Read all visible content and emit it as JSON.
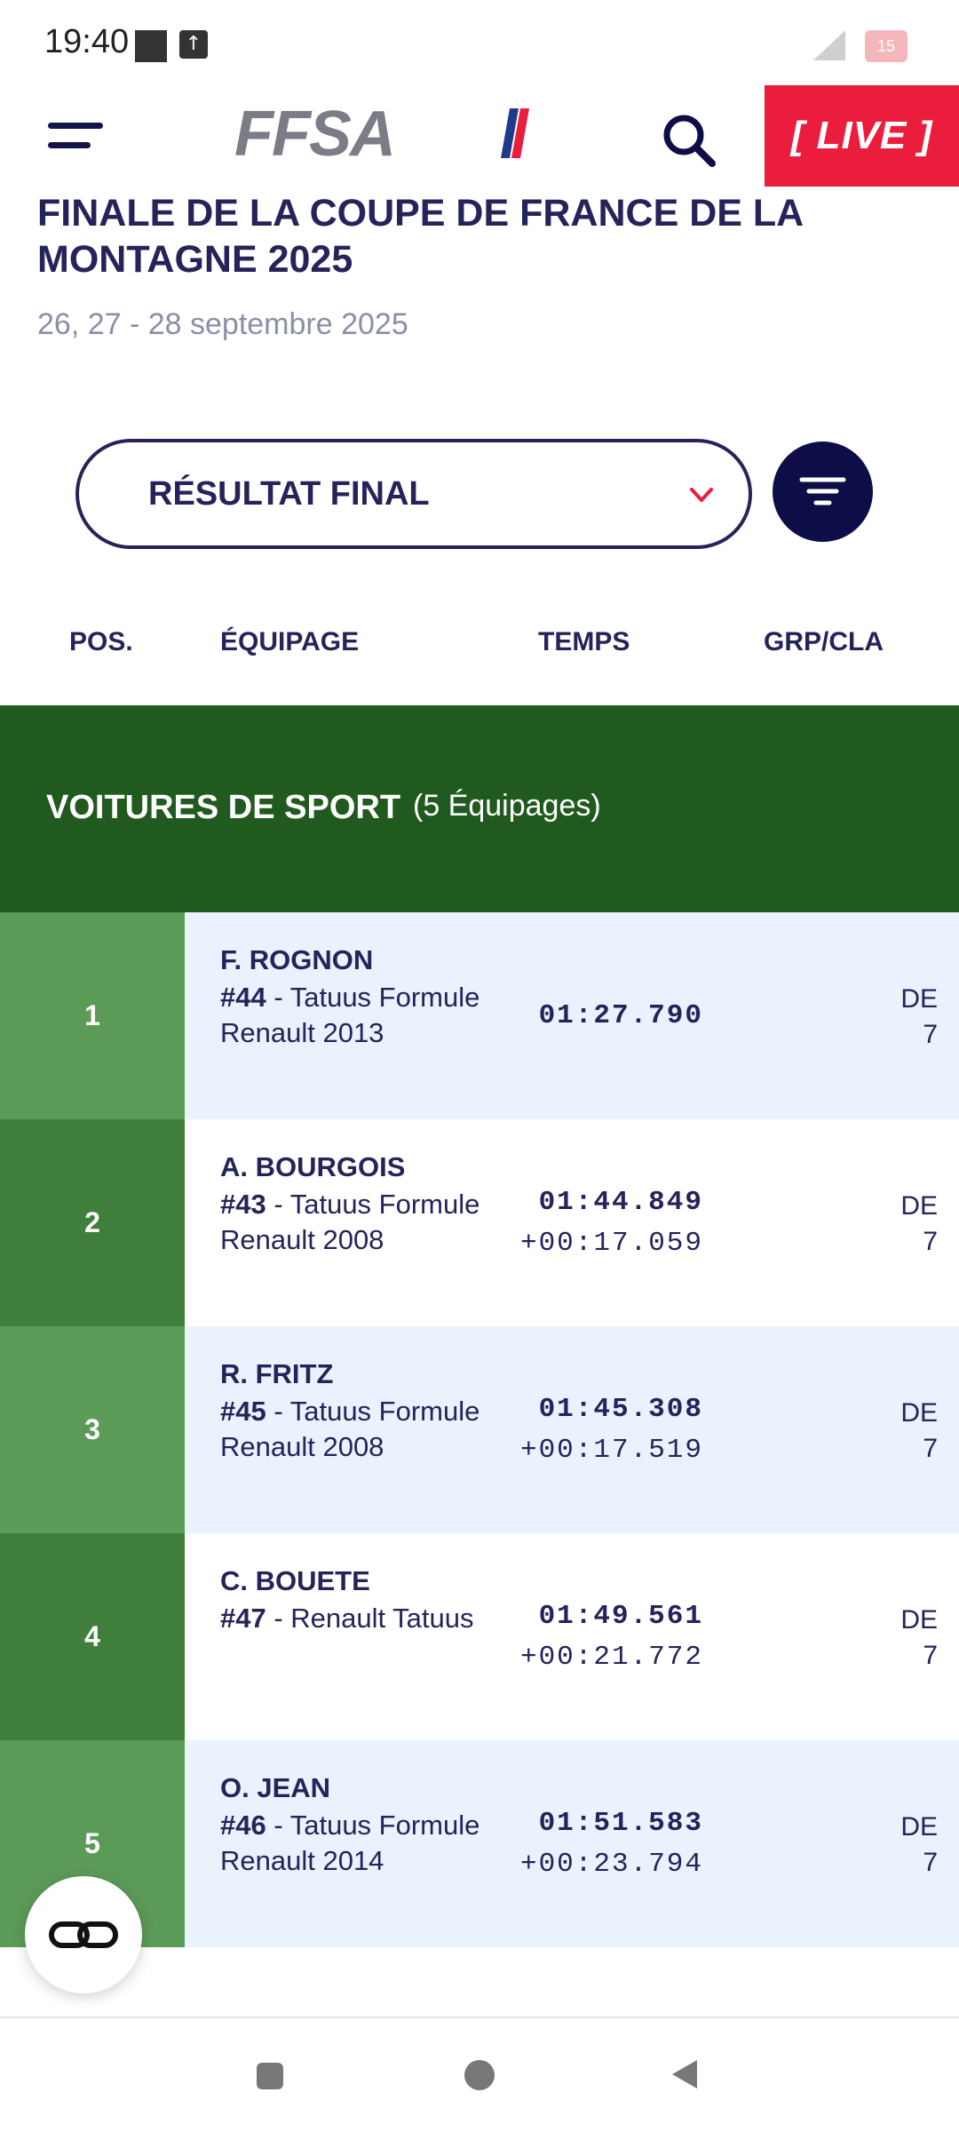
{
  "status_bar": {
    "time": "19:40",
    "battery": "15"
  },
  "header": {
    "logo_text": "FFSA",
    "live_label": "[ LIVE ]"
  },
  "event": {
    "title": "FINALE DE LA COUPE DE FRANCE DE LA MONTAGNE 2025",
    "date": "26, 27 - 28 septembre 2025"
  },
  "result_select": {
    "value": "RÉSULTAT FINAL"
  },
  "columns": {
    "pos": "POS.",
    "crew": "ÉQUIPAGE",
    "time": "TEMPS",
    "grp": "GRP/CLA"
  },
  "category": {
    "name": "VOITURES DE SPORT",
    "count": "(5 Équipages)"
  },
  "results": [
    {
      "pos": "1",
      "driver": "F. ROGNON",
      "number": "#44",
      "car": " - Tatuus Formule Renault 2013",
      "time": "01:27.790",
      "gap": "",
      "grp": "DE",
      "cla": "7"
    },
    {
      "pos": "2",
      "driver": "A. BOURGOIS",
      "number": "#43",
      "car": " - Tatuus Formule Renault 2008",
      "time": "01:44.849",
      "gap": "+00:17.059",
      "grp": "DE",
      "cla": "7"
    },
    {
      "pos": "3",
      "driver": "R. FRITZ",
      "number": "#45",
      "car": " - Tatuus Formule Renault 2008",
      "time": "01:45.308",
      "gap": "+00:17.519",
      "grp": "DE",
      "cla": "7"
    },
    {
      "pos": "4",
      "driver": "C. BOUETE",
      "number": "#47",
      "car": " - Renault Tatuus",
      "time": "01:49.561",
      "gap": "+00:21.772",
      "grp": "DE",
      "cla": "7"
    },
    {
      "pos": "5",
      "driver": "O. JEAN",
      "number": "#46",
      "car": " - Tatuus Formule Renault 2014",
      "time": "01:51.583",
      "gap": "+00:23.794",
      "grp": "DE",
      "cla": "7"
    }
  ],
  "colors": {
    "accent": "#ea1d3d",
    "navy": "#24245a",
    "category_bg": "#215a1e",
    "pos_light": "#5c9a58",
    "pos_dark": "#3f7f3b",
    "row_light": "#e9f2fd",
    "row_white": "#ffffff"
  },
  "icons": {
    "menu": "hamburger-menu-icon",
    "search": "search-icon",
    "chevron": "chevron-down-icon",
    "filter": "filter-icon",
    "float": "link-icon"
  }
}
